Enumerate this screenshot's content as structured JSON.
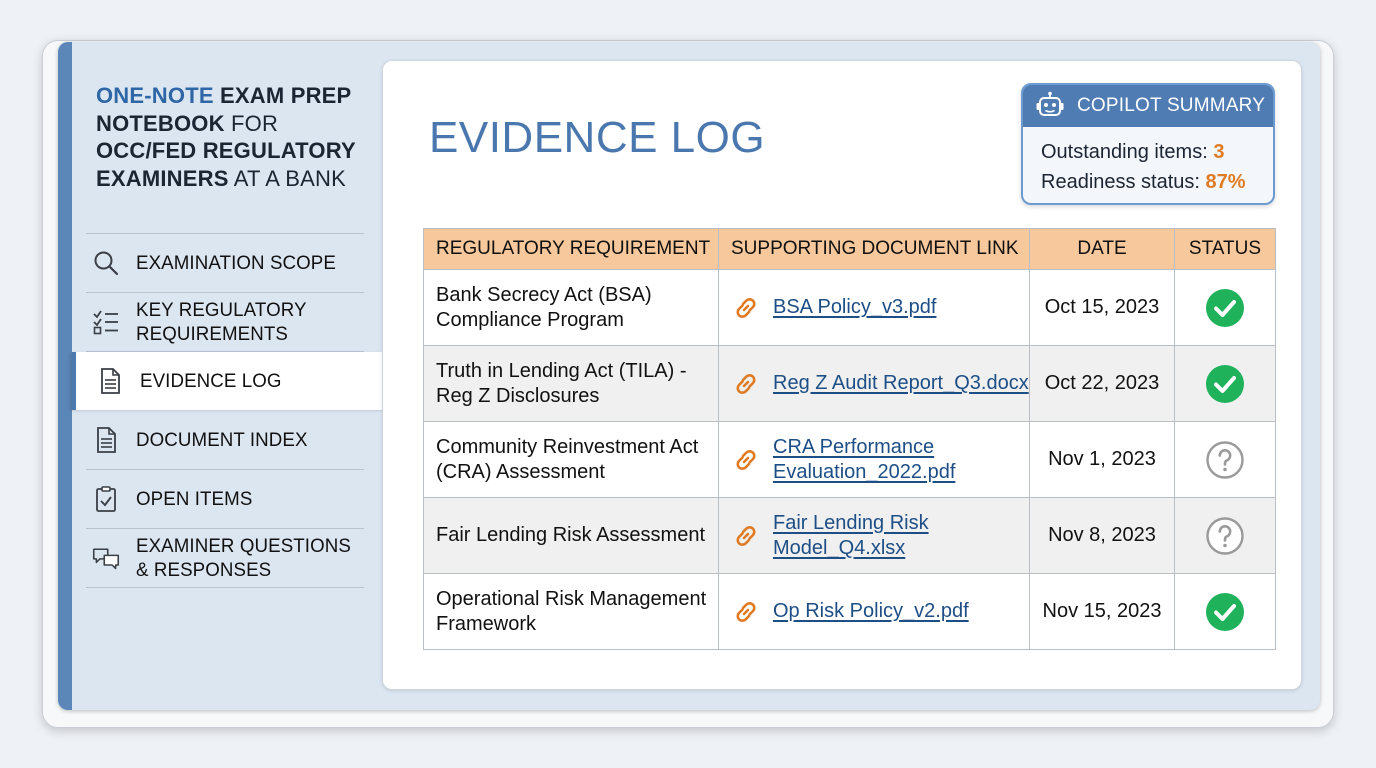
{
  "notebook": {
    "title_part1": "One-Note",
    "title_part2": " Exam Prep",
    "title_part3": "Notebook",
    "title_part4": " for",
    "title_part5": "OCC/Fed Regulatory",
    "title_part6": "Examiners",
    "title_part7": " at a Bank"
  },
  "nav": {
    "items": [
      {
        "label": "Examination Scope",
        "icon": "search-icon"
      },
      {
        "label": "Key Regulatory Requirements",
        "icon": "checklist-icon"
      },
      {
        "label": "Evidence Log",
        "icon": "document-icon",
        "active": true
      },
      {
        "label": "Document Index",
        "icon": "document-icon"
      },
      {
        "label": "Open Items",
        "icon": "clipboard-check-icon"
      },
      {
        "label": "Examiner Questions & Responses",
        "icon": "chat-bubbles-icon"
      }
    ]
  },
  "page": {
    "title": "Evidence Log"
  },
  "copilot": {
    "title": "COPILOT SUMMARY",
    "outstanding_label": "Outstanding items: ",
    "outstanding_value": "3",
    "readiness_label": "Readiness status: ",
    "readiness_value": "87%"
  },
  "table": {
    "headers": [
      "Regulatory Requirement",
      "Supporting Document Link",
      "Date",
      "Status"
    ],
    "rows": [
      {
        "requirement": "Bank Secrecy Act (BSA) Compliance Program",
        "document": "BSA Policy_v3.pdf",
        "date": "Oct 15, 2023",
        "status": "complete"
      },
      {
        "requirement": "Truth in Lending Act (TILA) - Reg Z Disclosures",
        "document": "Reg Z Audit Report_Q3.docx",
        "date": "Oct 22, 2023",
        "status": "complete"
      },
      {
        "requirement": "Community Reinvestment Act (CRA) Assessment",
        "document": "CRA Performance Evaluation_2022.pdf",
        "date": "Nov 1, 2023",
        "status": "pending"
      },
      {
        "requirement": "Fair Lending Risk Assessment",
        "document": "Fair Lending Risk Model_Q4.xlsx",
        "date": "Nov 8, 2023",
        "status": "pending"
      },
      {
        "requirement": "Operational Risk Management Framework",
        "document": "Op Risk Policy_v2.pdf",
        "date": "Nov 15, 2023",
        "status": "complete"
      }
    ]
  },
  "colors": {
    "accent": "#4a78ae",
    "header_bg": "#f7c89b",
    "highlight": "#e07b24",
    "complete": "#1fb25a",
    "pending": "#9a9a9a"
  }
}
